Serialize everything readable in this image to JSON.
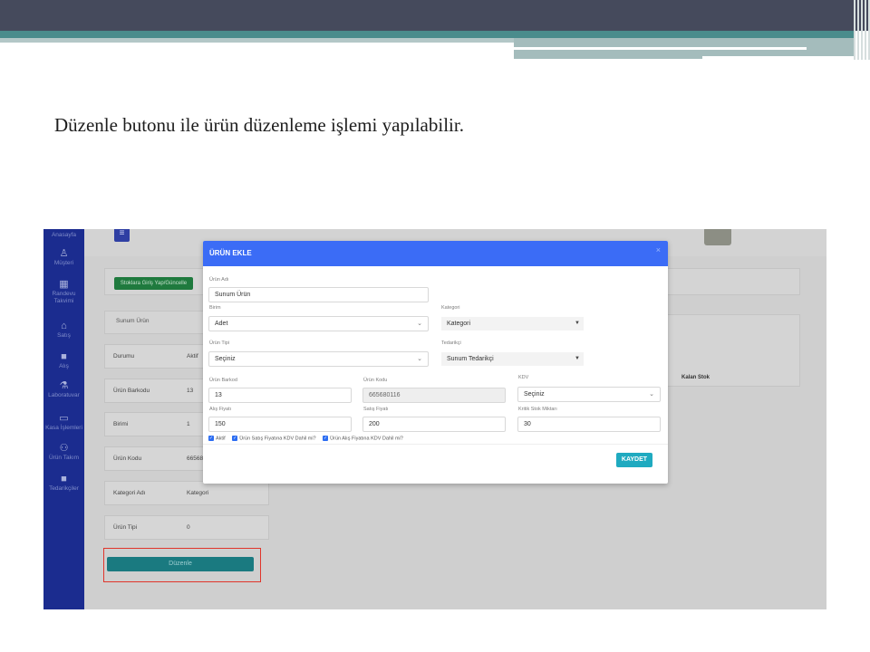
{
  "slide": {
    "caption": "Düzenle butonu ile ürün düzenleme işlemi yapılabilir."
  },
  "sidebar": {
    "items": [
      {
        "label": "Anasayfa",
        "icon": "home-icon"
      },
      {
        "label": "Müşteri",
        "icon": "user-icon"
      },
      {
        "label": "Randevu Takvimi",
        "icon": "calendar-icon"
      },
      {
        "label": "Satış",
        "icon": "basket-icon"
      },
      {
        "label": "Alış",
        "icon": "truck-icon"
      },
      {
        "label": "Laboratuvar",
        "icon": "flask-icon"
      },
      {
        "label": "Kasa İşlemleri",
        "icon": "cash-icon"
      },
      {
        "label": "Ürün Takım",
        "icon": "people-icon"
      },
      {
        "label": "Tedarikçiler",
        "icon": "truck-icon"
      }
    ]
  },
  "background": {
    "stock_button": "Stoklara Giriş Yap/Güncelle",
    "product_name": "Sunum Ürün",
    "fields": [
      {
        "key": "Durumu",
        "value": "Aktif"
      },
      {
        "key": "Ürün Barkodu",
        "value": "13"
      },
      {
        "key": "Birimi",
        "value": "1"
      },
      {
        "key": "Ürün Kodu",
        "value": "665680116"
      },
      {
        "key": "Kategori Adı",
        "value": "Kategori"
      },
      {
        "key": "Ürün Tipi",
        "value": "0"
      }
    ],
    "kalan_stok": "Kalan Stok",
    "edit_button": "Düzenle"
  },
  "modal": {
    "title": "ÜRÜN EKLE",
    "close": "×",
    "urun_adi": {
      "label": "Ürün Adı",
      "value": "Sunum Ürün"
    },
    "birimi": {
      "label": "Birim",
      "value": "Adet"
    },
    "kategori": {
      "label": "Kategori",
      "value": "Kategori"
    },
    "urun_tipi": {
      "label": "Ürün Tipi",
      "value": "Seçiniz"
    },
    "tedarikci": {
      "label": "Tedarikçi",
      "value": "Sunum Tedarikçi"
    },
    "urun_barkod": {
      "label": "Ürün Barkod",
      "value": "13"
    },
    "urun_kodu": {
      "label": "Ürün Kodu",
      "value": "665680116"
    },
    "kdv": {
      "label": "KDV",
      "value": "Seçiniz"
    },
    "alis_fiyati": {
      "label": "Alış Fiyatı",
      "value": "150"
    },
    "satis_fiyati": {
      "label": "Satış Fiyatı",
      "value": "200"
    },
    "kritik_stok": {
      "label": "Kritik Stok Miktarı",
      "value": "30"
    },
    "checkboxes": [
      "Aktif",
      "Ürün Satış Fiyatına KDV Dahil mi?",
      "Ürün Alış Fiyatına KDV Dahil mi?"
    ],
    "save_button": "KAYDET"
  },
  "colors": {
    "header_band": "#454a5c",
    "teal_accent": "#4a8c8c",
    "sidebar": "#1b2c8f",
    "modal_header": "#3b6cf6",
    "save_button": "#1faac0",
    "edit_button": "#1a7a80",
    "highlight_box": "#e0352b"
  }
}
